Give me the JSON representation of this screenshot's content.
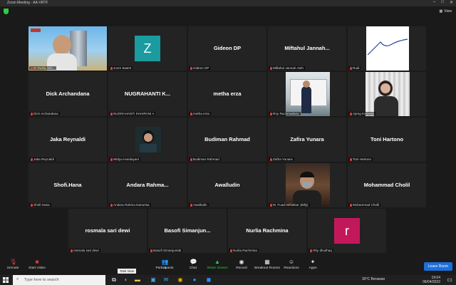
{
  "window": {
    "title": "Zoom Meeting - AA-VRTF"
  },
  "topbar": {
    "view_label": "View"
  },
  "participants": [
    {
      "name_label": "M.Taufiq ARI...",
      "type": "video"
    },
    {
      "name_label": "zoom 8aa04",
      "type": "avatar",
      "initial": "Z",
      "color": "#1a9ba0"
    },
    {
      "display_name": "Gideon DP",
      "name_label": "Gideon DP",
      "type": "name"
    },
    {
      "display_name": "Miftahul  Jannah...",
      "name_label": "Miftahul Jannah Ateh",
      "type": "name"
    },
    {
      "name_label": "Rudi",
      "type": "graph"
    },
    {
      "display_name": "Dick Archandana",
      "name_label": "Dick Archandana",
      "type": "name"
    },
    {
      "display_name": "NUGRAHANTI  K...",
      "name_label": "NUGRAHANTI KHAIRANI A",
      "type": "name"
    },
    {
      "display_name": "metha erza",
      "name_label": "metha erza",
      "type": "name"
    },
    {
      "name_label": "Roy Rachmadany",
      "type": "photo"
    },
    {
      "name_label": "Ajeng Karasati",
      "type": "photo"
    },
    {
      "display_name": "Jaka Reynaldi",
      "name_label": "Jaka Reynaldi",
      "type": "name"
    },
    {
      "name_label": "Widya Handayani",
      "type": "photo"
    },
    {
      "display_name": "Budiman Rahmad",
      "name_label": "Budiman Rahmad",
      "type": "name"
    },
    {
      "display_name": "Zafira Yunara",
      "name_label": "Zafira Yunara",
      "type": "name"
    },
    {
      "display_name": "Toni Hartono",
      "name_label": "Toni Hartono",
      "type": "name"
    },
    {
      "display_name": "Shofi.Hana",
      "name_label": "Shofi.Hana",
      "type": "name"
    },
    {
      "display_name": "Andara  Rahma...",
      "name_label": "Andara Rahma Danurisa",
      "type": "name"
    },
    {
      "display_name": "Awalludin",
      "name_label": "Awalludin",
      "type": "name"
    },
    {
      "name_label": "M. Fuadi Bilfakkar (Billy)",
      "type": "photo"
    },
    {
      "display_name": "Mohammad Cholil",
      "name_label": "Mohammad Cholil",
      "type": "name"
    },
    {
      "display_name": "rosmala sari dewi",
      "name_label": "rosmala sari dewi",
      "type": "name"
    },
    {
      "display_name": "Basofi  Simanjun...",
      "name_label": "Basofi Simanjuntak",
      "type": "name"
    },
    {
      "display_name": "Nurlia Rachmina",
      "name_label": "Nurlia Rachmina",
      "type": "name"
    },
    {
      "name_label": "rRiy dinulhaq",
      "type": "avatar",
      "initial": "r",
      "color": "#c2185b"
    }
  ],
  "toolbar": {
    "unmute": "Unmute",
    "start_video": "Start Video",
    "participants": "Participants",
    "participants_count": "24",
    "chat": "Chat",
    "share_screen": "Share Screen",
    "record": "Record",
    "breakout": "Breakout Rooms",
    "reactions": "Reactions",
    "apps": "Apps",
    "leave": "Leave Room",
    "tooltip": "Task View"
  },
  "taskbar": {
    "search_placeholder": "Type here to search",
    "weather": "30°C  Berawan",
    "time": "19:04",
    "date": "06/04/2022"
  },
  "colors": {
    "accent": "#1e6fd9",
    "share": "#2ecc40",
    "active_speaker": "#d8d832"
  }
}
